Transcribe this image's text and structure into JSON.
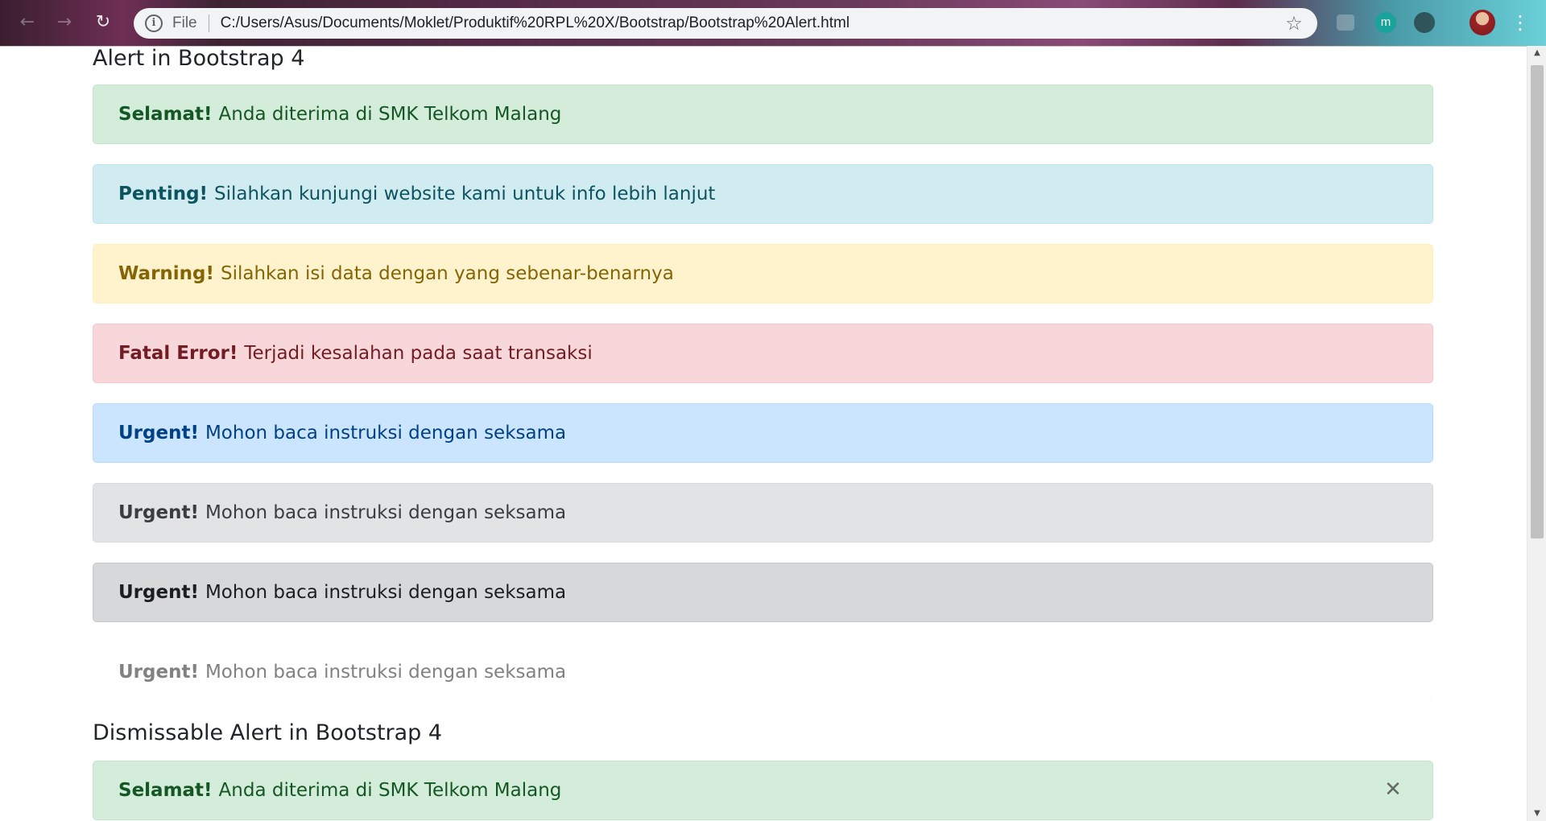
{
  "browser": {
    "file_label": "File",
    "url": "C:/Users/Asus/Documents/Moklet/Produktif%20RPL%20X/Bootstrap/Bootstrap%20Alert.html",
    "ext_m_label": "m",
    "back_icon": "arrow-left-icon",
    "forward_icon": "arrow-right-icon",
    "reload_icon": "reload-icon",
    "star_icon": "star-icon"
  },
  "page": {
    "heading1": "Alert in Bootstrap 4",
    "heading2": "Dismissable Alert in Bootstrap 4",
    "alerts": [
      {
        "strong": "Selamat!",
        "text": "Anda diterima di SMK Telkom Malang",
        "variant": "success"
      },
      {
        "strong": "Penting!",
        "text": "Silahkan kunjungi website kami untuk info lebih lanjut",
        "variant": "info"
      },
      {
        "strong": "Warning!",
        "text": "Silahkan isi data dengan yang sebenar-benarnya",
        "variant": "warning"
      },
      {
        "strong": "Fatal Error!",
        "text": "Terjadi kesalahan pada saat transaksi",
        "variant": "danger"
      },
      {
        "strong": "Urgent!",
        "text": "Mohon baca instruksi dengan seksama",
        "variant": "primary"
      },
      {
        "strong": "Urgent!",
        "text": "Mohon baca instruksi dengan seksama",
        "variant": "secondary"
      },
      {
        "strong": "Urgent!",
        "text": "Mohon baca instruksi dengan seksama",
        "variant": "dark"
      },
      {
        "strong": "Urgent!",
        "text": "Mohon baca instruksi dengan seksama",
        "variant": "light"
      }
    ],
    "dismissable": {
      "strong": "Selamat!",
      "text": "Anda diterima di SMK Telkom Malang",
      "variant": "success",
      "close_symbol": "✕"
    }
  },
  "colors": {
    "success_bg": "#d4edda",
    "info_bg": "#d1ecf1",
    "warning_bg": "#fff3cd",
    "danger_bg": "#f8d7da",
    "primary_bg": "#cce5ff",
    "secondary_bg": "#e2e3e5",
    "dark_bg": "#d6d8d9",
    "light_bg": "#fefefe"
  }
}
